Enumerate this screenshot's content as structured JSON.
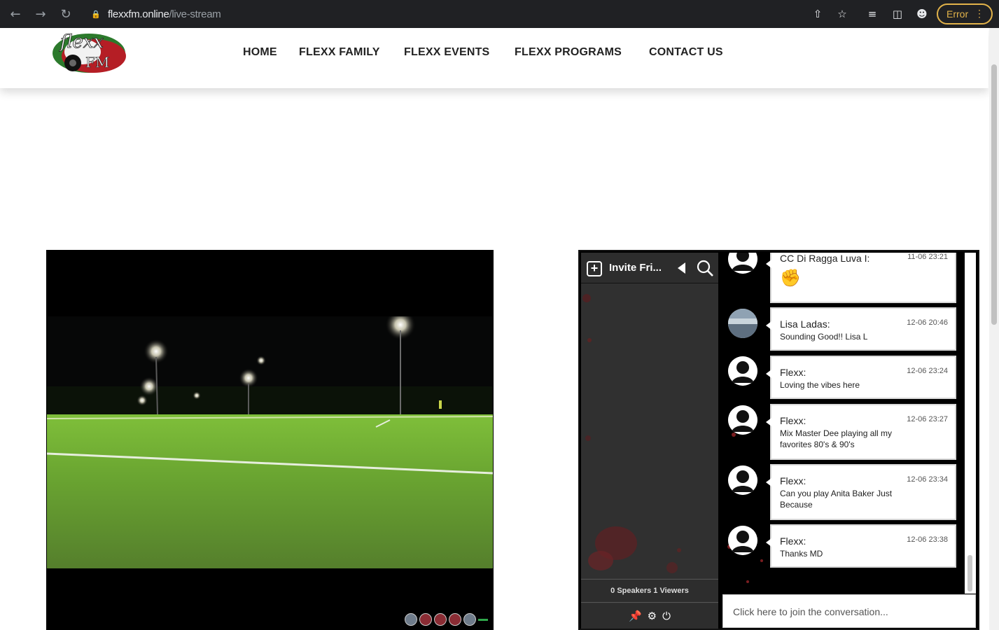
{
  "browser": {
    "back_icon": "arrow-left-icon",
    "forward_icon": "arrow-right-icon",
    "reload_icon": "reload-icon",
    "url_host": "flexxfm.online",
    "url_path": "/live-stream",
    "error_label": "Error"
  },
  "site": {
    "logo_text_top": "flexx",
    "logo_text_bottom": "FM",
    "nav": [
      "HOME",
      "FLEXX FAMILY",
      "FLEXX EVENTS",
      "FLEXX PROGRAMS",
      "CONTACT US"
    ]
  },
  "chat": {
    "invite_label": "Invite Fri...",
    "speakers_label": "0 Speakers 1 Viewers",
    "join_placeholder": "Click here to join the conversation...",
    "messages": [
      {
        "name": "CC Di Ragga Luva I:",
        "time": "11-06 23:21",
        "text": "",
        "emoji": "fist-emoji"
      },
      {
        "name": "Lisa Ladas:",
        "time": "12-06 20:46",
        "text": "Sounding Good!! Lisa L"
      },
      {
        "name": "Flexx:",
        "time": "12-06 23:24",
        "text": "Loving the vibes here"
      },
      {
        "name": "Flexx:",
        "time": "12-06 23:27",
        "text": "Mix Master Dee playing all my favorites 80's & 90's"
      },
      {
        "name": "Flexx:",
        "time": "12-06 23:34",
        "text": "Can you play Anita Baker Just Because"
      },
      {
        "name": "Flexx:",
        "time": "12-06 23:38",
        "text": "Thanks MD"
      }
    ]
  }
}
